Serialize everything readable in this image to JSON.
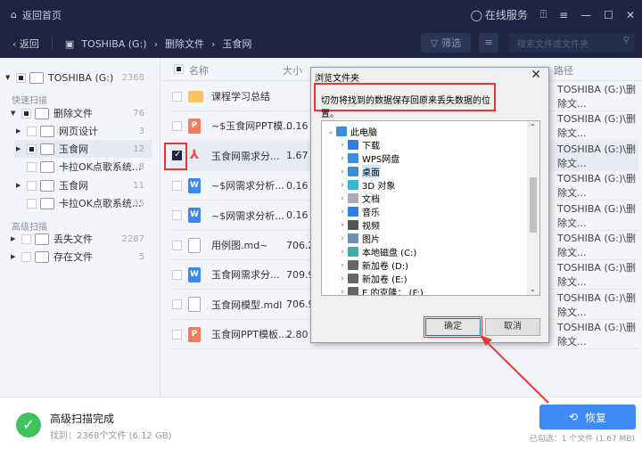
{
  "titlebar": {
    "home": "返回首页",
    "service": "在线服务"
  },
  "nav": {
    "back": "返回",
    "crumbs": [
      "TOSHIBA (G:)",
      "删除文件",
      "玉食网"
    ],
    "filter": "筛选",
    "search_placeholder": "搜索文件或文件夹"
  },
  "sidebar": {
    "drive": {
      "label": "TOSHIBA (G:)",
      "count": "2368"
    },
    "quick_scan": "快速扫描",
    "items": [
      {
        "label": "删除文件",
        "count": "76"
      },
      {
        "label": "网页设计",
        "count": "3"
      },
      {
        "label": "玉食网",
        "count": "12"
      },
      {
        "label": "卡拉OK点歌系统...",
        "count": "8"
      },
      {
        "label": "玉食网",
        "count": "11"
      },
      {
        "label": "卡拉OK点歌系统...",
        "count": "35"
      }
    ],
    "advanced_scan": "高级扫描",
    "adv_items": [
      {
        "label": "丢失文件",
        "count": "2287"
      },
      {
        "label": "存在文件",
        "count": "5"
      }
    ]
  },
  "columns": {
    "name": "名称",
    "size": "大小",
    "path": "路径"
  },
  "files": [
    {
      "name": "课程学习总结",
      "size": "",
      "type": "folder",
      "path": "TOSHIBA (G:)\\删除文..."
    },
    {
      "name": "~$玉食网PPT模...",
      "size": "0.16 K",
      "type": "ppt",
      "path": "TOSHIBA (G:)\\删除文..."
    },
    {
      "name": "玉食网需求分...",
      "size": "1.67 M",
      "type": "pdf",
      "path": "TOSHIBA (G:)\\删除文...",
      "checked": true
    },
    {
      "name": "~$网需求分析...",
      "size": "0.16 K",
      "type": "word",
      "path": "TOSHIBA (G:)\\删除文..."
    },
    {
      "name": "~$网需求分析...",
      "size": "0.16 K",
      "type": "word",
      "path": "TOSHIBA (G:)\\删除文..."
    },
    {
      "name": "用例图.md~",
      "size": "706.22",
      "type": "doc",
      "path": "TOSHIBA (G:)\\删除文..."
    },
    {
      "name": "玉食网需求分...",
      "size": "709.97",
      "type": "word",
      "path": "TOSHIBA (G:)\\删除文..."
    },
    {
      "name": "玉食网模型.mdl",
      "size": "706.92",
      "type": "doc",
      "path": "TOSHIBA (G:)\\删除文..."
    },
    {
      "name": "玉食网PPT模板....",
      "size": "2.80 M",
      "type": "ppt",
      "path": "TOSHIBA (G:)\\删除文..."
    }
  ],
  "dialog": {
    "title": "浏览文件夹",
    "warning": "切勿将找到的数据保存回原来丢失数据的位置。",
    "tree": [
      "此电脑",
      "下载",
      "WPS网盘",
      "桌面",
      "3D 对象",
      "文档",
      "音乐",
      "视频",
      "图片",
      "本地磁盘 (C:)",
      "新加卷 (D:)",
      "新加卷 (E:)",
      "E 的克隆：  (F:)"
    ],
    "ok": "确定",
    "cancel": "取消"
  },
  "status": {
    "title": "高级扫描完成",
    "found": "找到：2368个文件 (6.12 GB)",
    "recover": "恢复",
    "selected": "已勾选：1 个文件 (1.67 MB)"
  }
}
